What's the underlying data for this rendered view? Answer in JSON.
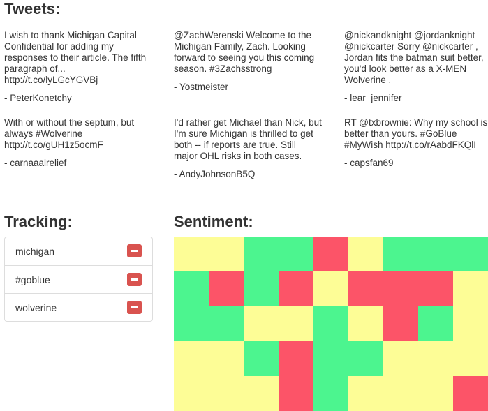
{
  "headings": {
    "tweets": "Tweets:",
    "tracking": "Tracking:",
    "sentiment": "Sentiment:"
  },
  "tweets": [
    {
      "text": "I wish to thank Michigan Capital Confidential for adding my responses to their article. The fifth paragraph of... http://t.co/lyLGcYGVBj",
      "author": "- PeterKonetchy"
    },
    {
      "text": "@ZachWerenski Welcome to the Michigan Family, Zach. Looking forward to seeing you this coming season. #3Zachsstrong",
      "author": "- Yostmeister"
    },
    {
      "text": "@nickandknight @jordanknight @nickcarter Sorry @nickcarter , Jordan fits the batman suit better, you'd look better as a X-MEN Wolverine .",
      "author": "- lear_jennifer"
    },
    {
      "text": "With or without the septum, but always #Wolverine http://t.co/gUH1z5ocmF",
      "author": "- carnaaalrelief"
    },
    {
      "text": "I'd rather get Michael than Nick, but I'm sure Michigan is thrilled to get both -- if reports are true. Still major OHL risks in both cases.",
      "author": "- AndyJohnsonB5Q"
    },
    {
      "text": "RT @txbrownie: Why my school is better than yours. #GoBlue #MyWish http://t.co/rAabdFKQlI",
      "author": "- capsfan69"
    }
  ],
  "tracking": [
    {
      "label": "michigan"
    },
    {
      "label": "#goblue"
    },
    {
      "label": "wolverine"
    }
  ],
  "colors": {
    "positive": "#4cf58f",
    "neutral": "#fdfd96",
    "negative": "#fc5468",
    "remove": "#d9534f"
  },
  "sentiment_grid": [
    [
      "neutral",
      "neutral",
      "positive",
      "positive",
      "negative",
      "neutral",
      "positive",
      "positive",
      "positive"
    ],
    [
      "positive",
      "negative",
      "positive",
      "negative",
      "neutral",
      "negative",
      "negative",
      "negative",
      "neutral"
    ],
    [
      "positive",
      "positive",
      "neutral",
      "neutral",
      "positive",
      "neutral",
      "negative",
      "positive",
      "neutral"
    ],
    [
      "neutral",
      "neutral",
      "positive",
      "negative",
      "positive",
      "positive",
      "neutral",
      "neutral",
      "neutral"
    ],
    [
      "neutral",
      "neutral",
      "neutral",
      "negative",
      "positive",
      "neutral",
      "neutral",
      "neutral",
      "negative"
    ]
  ]
}
